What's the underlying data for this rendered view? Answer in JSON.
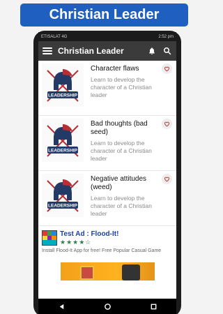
{
  "promo": {
    "title": "Christian Leader"
  },
  "status_bar": {
    "left": "ETISALAT 4G",
    "right": "2:52 pm"
  },
  "app_bar": {
    "title": "Christian Leader"
  },
  "items": [
    {
      "title": "Character flaws",
      "description": "Learn to develop the character of a Christian leader",
      "badge": "LEADERSHIP"
    },
    {
      "title": "Bad thoughts (bad seed)",
      "description": "Learn to develop the character of a Christian leader",
      "badge": "LEADERSHIP"
    },
    {
      "title": "Negative attitudes (weed)",
      "description": "Learn to develop the character of a Christian leader",
      "badge": "LEADERSHIP"
    }
  ],
  "ad": {
    "title": "Test Ad : Flood-It!",
    "icon_label": "Flood-It!",
    "rating": "4 of 5 stars",
    "description": "Install Flood-It App for free! Free Popular Casual Game"
  },
  "colors": {
    "promo": "#1f5fbf",
    "app_bar": "#3b3b3b",
    "accent": "#b72f34"
  }
}
